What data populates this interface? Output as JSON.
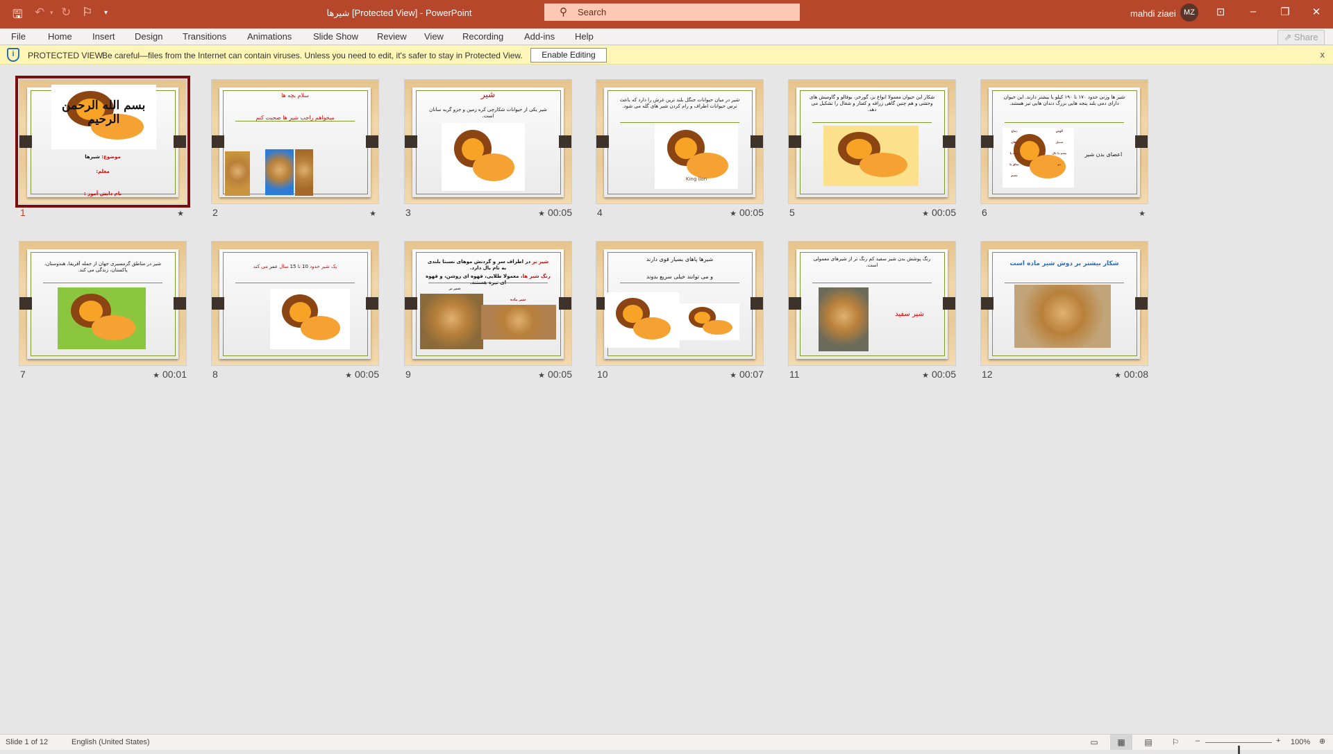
{
  "titlebar": {
    "doc_title": "شیرها [Protected View]  -  PowerPoint",
    "search_placeholder": "Search",
    "user": "mahdi ziaei",
    "avatar": "MZ",
    "icons": [
      "save-icon",
      "undo-icon",
      "redo-icon",
      "present-icon",
      "customize-icon"
    ],
    "accent": "#b7472a"
  },
  "ribbon": {
    "tabs": [
      "File",
      "Home",
      "Insert",
      "Design",
      "Transitions",
      "Animations",
      "Slide Show",
      "Review",
      "View",
      "Recording",
      "Add-ins",
      "Help"
    ],
    "share": "Share"
  },
  "protected_view": {
    "label": "PROTECTED VIEW",
    "message": "Be careful—files from the Internet can contain viruses. Unless you need to edit, it's safer to stay in Protected View.",
    "button": "Enable Editing",
    "close": "x"
  },
  "slides": [
    {
      "number": "1",
      "timing": "",
      "star": "★",
      "selected": true,
      "calligraphy": "بسم الله الرحمن الرحیم",
      "lines": [
        [
          {
            "t": "موضوع: ",
            "c": "#e00000"
          },
          {
            "t": "شیرها",
            "c": "#111"
          }
        ],
        [
          {
            "t": "معلم:",
            "c": "#e00000"
          }
        ],
        [
          {
            "t": "نام دانش آموز :",
            "c": "#e00000"
          }
        ]
      ],
      "images": [
        "calligraphy-image"
      ]
    },
    {
      "number": "2",
      "timing": "",
      "star": "★",
      "lines": [
        [
          {
            "t": "سلام بچه ها",
            "c": "#e00000"
          }
        ],
        [
          {
            "t": "میخواهم راجب شیر ها صحبت کنم",
            "c": "#e00000"
          }
        ]
      ],
      "images": [
        "lion-photo",
        "lion-photo-sky",
        "lion-cubs-photo"
      ]
    },
    {
      "number": "3",
      "timing": "00:05",
      "star": "★",
      "lines": [
        [
          {
            "t": "شیر",
            "c": "#e00000"
          }
        ],
        [
          {
            "t": "شیر یکی از حیوانات شکارچی کره زمین و جزو گربه سانان است.",
            "c": "#111"
          }
        ]
      ],
      "images": [
        "cartoon-lion"
      ]
    },
    {
      "number": "4",
      "timing": "00:05",
      "star": "★",
      "lines": [
        [
          {
            "t": "شیر در میان حیوانات جنگل بلند ترین غرش را دارد که باعث ترس حیوانات اطراف و رام کردن شیر های گله می شود.",
            "c": "#111"
          }
        ]
      ],
      "images": [
        "king-lion-image"
      ],
      "image_caption": "King lion"
    },
    {
      "number": "5",
      "timing": "00:05",
      "star": "★",
      "lines": [
        [
          {
            "t": "شکار این حیوان معمولا انواع بز، گورخر، بوفالو و گاومیش های وحشی و هم چنین گاهی زرافه و کفتار و شغال را تشکیل می دهد.",
            "c": "#111"
          }
        ]
      ],
      "images": [
        "eating-lion-image"
      ]
    },
    {
      "number": "6",
      "timing": "",
      "star": "★",
      "lines": [
        [
          {
            "t": "شیر ها وزنی حدود ۱۷۰ تا ۱۹۰ کیلو یا بیشتر دارند. این حیوان دارای دمی بلند پنجه هایی بزرگ دندان هایی تیز هستند.",
            "c": "#111"
          }
        ]
      ],
      "side_text": "اعضای بدن شیر",
      "body_parts": [
        "گوش",
        "سبیل",
        "پشم یا یال",
        "دم",
        "چشم",
        "دماغ",
        "دهان",
        "پنجه پا",
        "ساق پا"
      ],
      "images": [
        "lion-anatomy-image"
      ]
    },
    {
      "number": "7",
      "timing": "00:01",
      "star": "★",
      "lines": [
        [
          {
            "t": "شیر در مناطق گرمسیری جهان از جمله آفریقا، هندوستان، پاکستان، زندگی می کند.",
            "c": "#111"
          }
        ]
      ],
      "images": [
        "lion-tree-image"
      ]
    },
    {
      "number": "8",
      "timing": "00:05",
      "star": "★",
      "lines": [
        [
          {
            "t": "یک شیر حدود ",
            "c": "#e00000"
          },
          {
            "t": "10",
            "c": "#111"
          },
          {
            "t": " تا ",
            "c": "#e00000"
          },
          {
            "t": "15",
            "c": "#111"
          },
          {
            "t": " سال ",
            "c": "#e00000"
          },
          {
            "t": "عمر ",
            "c": "#111"
          },
          {
            "t": "می کند",
            "c": "#e00000"
          }
        ]
      ],
      "images": [
        "sitting-lion-image"
      ]
    },
    {
      "number": "9",
      "timing": "00:05",
      "star": "★",
      "lines": [
        [
          {
            "t": "شیر نر ",
            "c": "#e00000"
          },
          {
            "t": "در اطراف سر و گردنش موهای نسبتا بلندی به نام یال دارد.",
            "c": "#111"
          }
        ],
        [
          {
            "t": "رنگ شیر ها، ",
            "c": "#e00000"
          },
          {
            "t": "معمولا طلایی، قهوه ای روشن، و قهوه ای تیره هستند.",
            "c": "#111"
          }
        ]
      ],
      "captions": [
        "شیر نر",
        "شیر ماده"
      ],
      "images": [
        "male-lion-photo",
        "female-lion-photo"
      ]
    },
    {
      "number": "10",
      "timing": "00:07",
      "star": "★",
      "lines": [
        [
          {
            "t": "شیرها پاهای بسیار قوی دارند",
            "c": "#111"
          }
        ],
        [
          {
            "t": "و می توانند خیلی سریع بدوند",
            "c": "#111"
          }
        ]
      ],
      "images": [
        "walking-lion-image",
        "lion-cub-image"
      ]
    },
    {
      "number": "11",
      "timing": "00:05",
      "star": "★",
      "lines": [
        [
          {
            "t": "رنگ پوشش بدن شیر سفید کم رنگ تر از شیرهای معمولی است.",
            "c": "#111"
          }
        ]
      ],
      "side_text": "شیر سفید",
      "images": [
        "white-lion-photo"
      ]
    },
    {
      "number": "12",
      "timing": "00:08",
      "star": "★",
      "lines": [
        [
          {
            "t": "شکار بیشتر بر دوش شیر ماده است",
            "c": "#1c6fc4"
          }
        ]
      ],
      "images": [
        "lioness-photo"
      ]
    }
  ],
  "statusbar": {
    "slide_info": "Slide 1 of 12",
    "language": "English (United States)",
    "zoom": "100%",
    "views": [
      "normal-view-icon",
      "slide-sorter-icon",
      "reading-view-icon",
      "slideshow-icon"
    ],
    "active_view": "slide-sorter-icon",
    "zoom_level_percent": 100
  }
}
